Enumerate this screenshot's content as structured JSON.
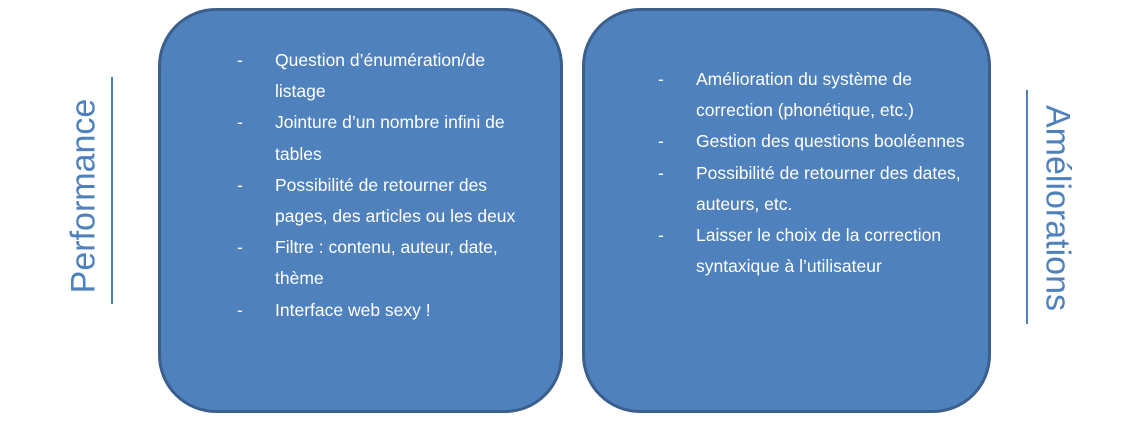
{
  "left_label": "Performance",
  "right_label": "Améliorations",
  "left_panel": {
    "items": [
      "Question d’énumération/de listage",
      "Jointure d’un nombre infini de tables",
      "Possibilité de retourner des pages, des articles ou les deux",
      "Filtre : contenu, auteur, date, thème",
      "Interface web sexy !"
    ]
  },
  "right_panel": {
    "items": [
      "Amélioration du système de correction (phonétique, etc.)",
      "Gestion des questions booléennes",
      "Possibilité de retourner des dates, auteurs, etc.",
      "Laisser le choix de la correction syntaxique à l’utilisateur"
    ]
  },
  "bullet": "-",
  "colors": {
    "panel_fill": "#4F81BD",
    "panel_border": "#3A5F8C",
    "label_text": "#4F81BD",
    "item_text": "#FFFFFF"
  }
}
